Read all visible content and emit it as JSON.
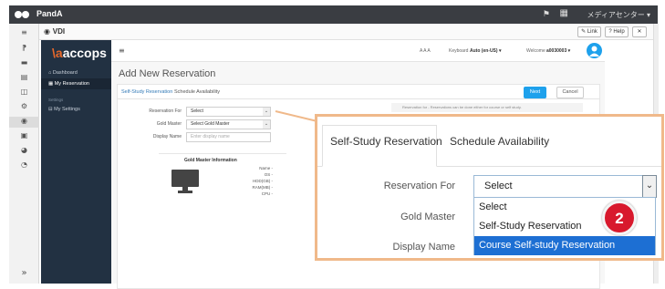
{
  "topbar": {
    "app_name": "PandA",
    "user_label": "メディアセンター ▾"
  },
  "vdibar": {
    "title": "VDI",
    "link_label": "✎ Link",
    "help_label": "? Help",
    "close_label": "✕"
  },
  "rail": {
    "icons": [
      "≡",
      "⁋",
      "▬",
      "▤",
      "◫",
      "⚙",
      "◉",
      "▣",
      "◕",
      "◔"
    ],
    "expand_label": "»"
  },
  "sidebar": {
    "brand_a": "\\a",
    "brand_rest": "accops",
    "items": [
      {
        "label": "⌂  Dashboard"
      },
      {
        "label": "▦  My Reservation"
      },
      {
        "label": "Settings"
      },
      {
        "label": "⊟  My Settings"
      }
    ]
  },
  "header": {
    "menu_icon": "≡",
    "font_sizes": "A A A",
    "keyboard_label": "Keyboard",
    "keyboard_value": "Auto (en-US) ▾",
    "welcome_label": "Welcome",
    "welcome_user": "a0030003 ▾"
  },
  "page": {
    "heading": "Add New Reservation",
    "tabs": [
      "Self-Study Reservation",
      "Schedule Availability"
    ],
    "next_label": "Next",
    "cancel_label": "Cancel",
    "info_text": "Reservation for - Reservations can be done either for course or self study.",
    "fields": {
      "reservation_for_label": "Reservation For",
      "reservation_for_value": "Select",
      "gold_master_label": "Gold Master",
      "gold_master_value": "Select Gold Master",
      "display_name_label": "Display Name",
      "display_name_placeholder": "Enter display name"
    },
    "gold_master_info": {
      "title": "Gold Master Information",
      "rows": [
        "Name -",
        "OS -",
        "HDD(GB) -",
        "RAM(MB) -",
        "CPU -"
      ]
    }
  },
  "zoom": {
    "tabs": [
      "Self-Study Reservation",
      "Schedule Availability"
    ],
    "reservation_for_label": "Reservation For",
    "gold_master_label": "Gold Master",
    "display_name_label": "Display Name",
    "select_value": "Select",
    "options": [
      "Select",
      "Self-Study Reservation",
      "Course Self-study Reservation"
    ],
    "selected_index": 2
  },
  "badge": {
    "number": "2"
  },
  "colors": {
    "accent": "#1ea1ec",
    "sidebar": "#223142",
    "callout_border": "#f0b98a",
    "badge": "#d8192d",
    "selected_option": "#1d6fd3"
  }
}
